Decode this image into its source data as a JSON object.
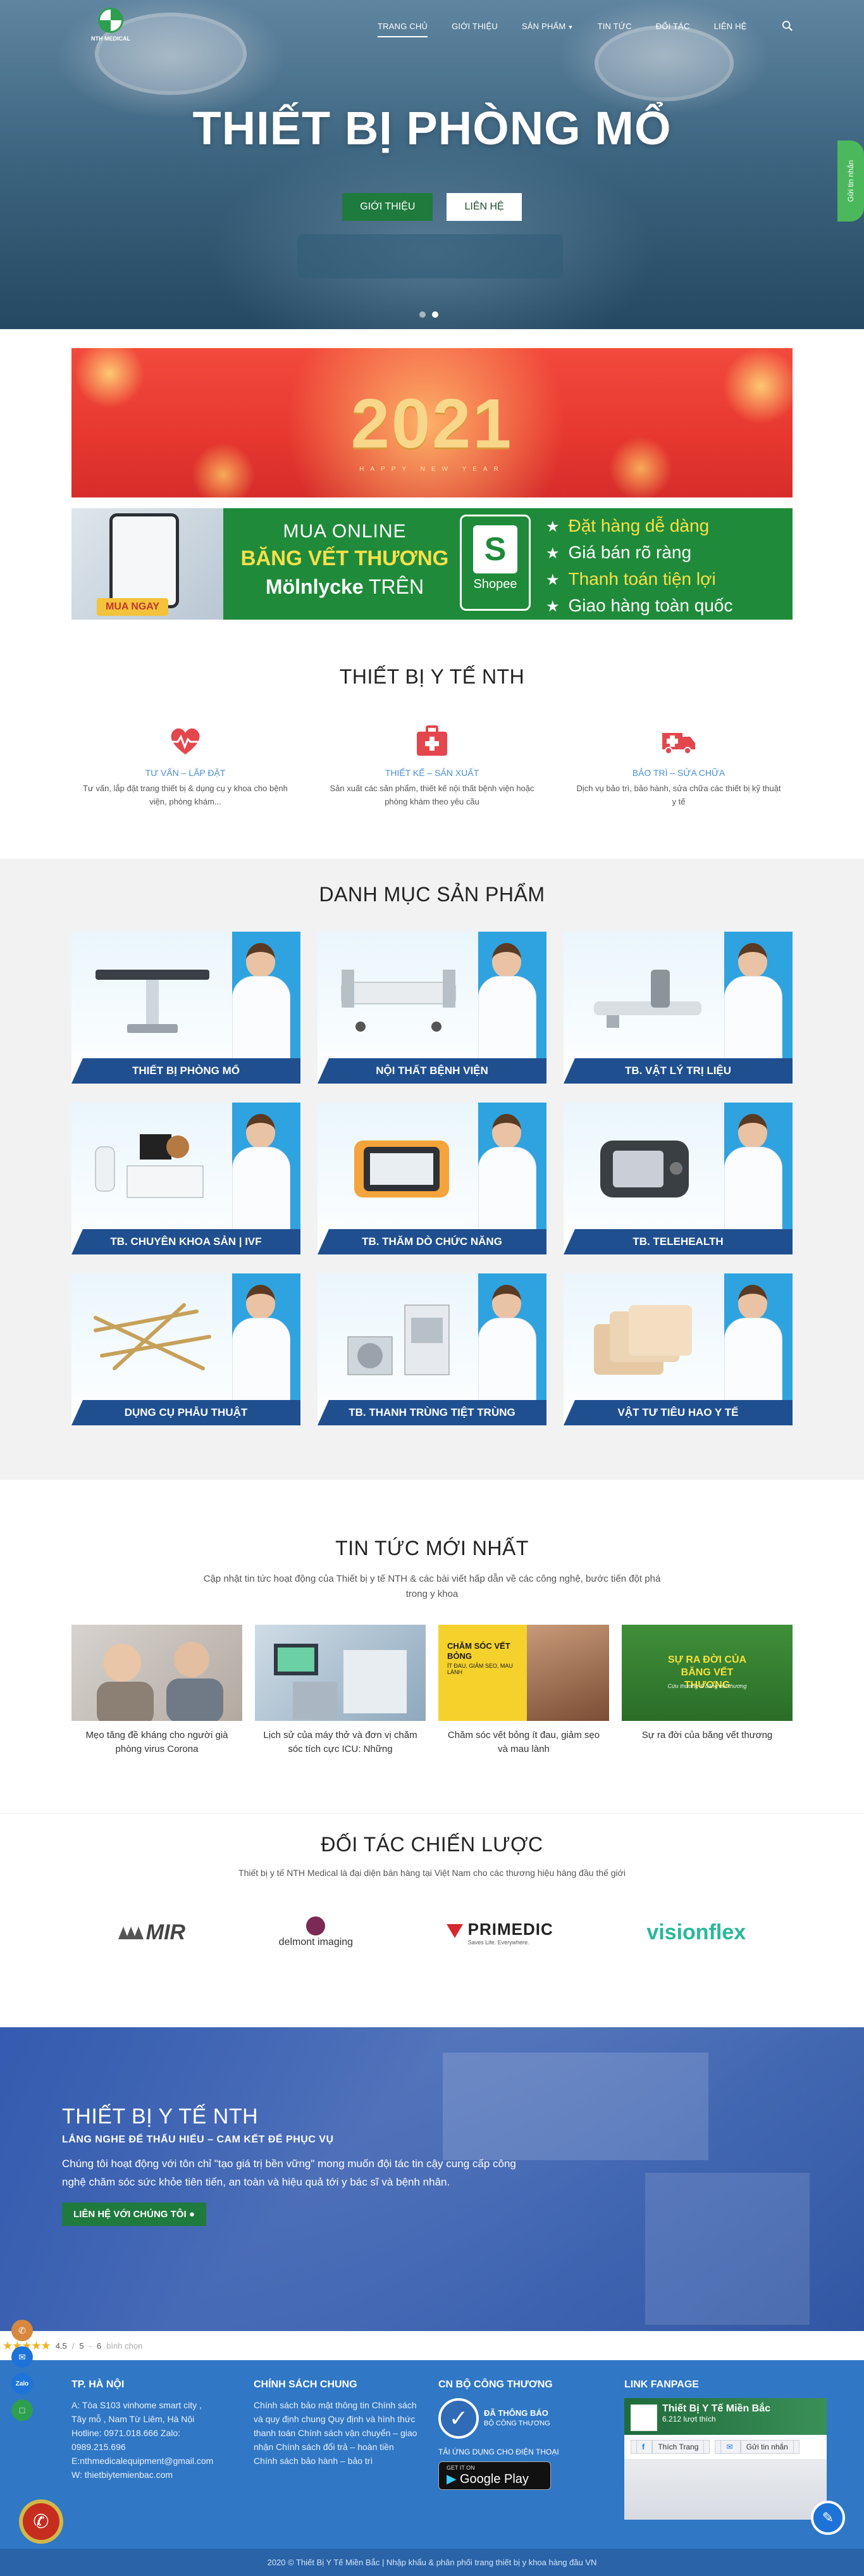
{
  "brand": {
    "logo_text": "NTH MEDICAL"
  },
  "nav": {
    "items": [
      {
        "label": "TRANG CHỦ",
        "active": true
      },
      {
        "label": "GIỚI THIỆU"
      },
      {
        "label": "SẢN PHẨM",
        "dropdown": true
      },
      {
        "label": "TIN TỨC"
      },
      {
        "label": "ĐỐI TÁC"
      },
      {
        "label": "LIÊN HỆ"
      }
    ]
  },
  "hero": {
    "title": "THIẾT BỊ PHÒNG MỔ",
    "primary_button": "GIỚI THIỆU",
    "secondary_button": "LIÊN HỆ",
    "side_tab": "Gửi tin nhắn"
  },
  "banners": {
    "year": "2021",
    "year_sub": "HAPPY NEW YEAR",
    "shop": {
      "buy_now": "MUA NGAY",
      "line1": "MUA ONLINE",
      "line2": "BĂNG VẾT THƯƠNG",
      "brand": "Mölnlycke",
      "line3_suffix": "TRÊN",
      "shopee": "Shopee",
      "features": [
        "Đặt hàng dễ dàng",
        "Giá bán rõ ràng",
        "Thanh toán tiện lợi",
        "Giao hàng toàn quốc"
      ]
    }
  },
  "services": {
    "title": "THIẾT BỊ Y TẾ NTH",
    "items": [
      {
        "title": "TƯ VẤN – LẮP ĐẶT",
        "desc": "Tư vấn, lắp đặt trang thiết bị & dụng cụ y khoa cho bệnh viện, phòng khám...",
        "icon": "heartbeat-icon"
      },
      {
        "title": "THIẾT KẾ – SẢN XUẤT",
        "desc": "Sản xuất các sản phẩm, thiết kế nội thất bệnh viện hoặc phòng khám theo yêu cầu",
        "icon": "medical-kit-icon"
      },
      {
        "title": "BẢO TRÌ – SỬA CHỮA",
        "desc": "Dịch vụ bảo trì, bảo hành, sửa chữa các thiết bị kỹ thuật y tế",
        "icon": "ambulance-icon"
      }
    ]
  },
  "categories": {
    "title": "DANH MỤC SẢN PHẨM",
    "items": [
      {
        "label": "THIẾT BỊ PHÒNG MỔ"
      },
      {
        "label": "NỘI THẤT BỆNH VIỆN"
      },
      {
        "label": "TB. VẬT LÝ TRỊ LIỆU"
      },
      {
        "label": "TB. CHUYÊN KHOA SẢN | IVF"
      },
      {
        "label": "TB. THĂM DÒ CHỨC NĂNG"
      },
      {
        "label": "TB. TELEHEALTH"
      },
      {
        "label": "DỤNG CỤ PHẪU THUẬT"
      },
      {
        "label": "TB. THANH TRÙNG TIỆT TRÙNG"
      },
      {
        "label": "VẬT TƯ TIÊU HAO Y TẾ"
      }
    ]
  },
  "news": {
    "title": "TIN TỨC MỚI NHẤT",
    "lead": "Cập nhật tin tức hoạt động của Thiết bị y tế NTH & các bài viết hấp dẫn về các công nghệ, bước tiến đột phá trong y khoa",
    "items": [
      {
        "title": "Mẹo tăng đề kháng cho người già phòng virus Corona"
      },
      {
        "title": "Lịch sử của máy thở và đơn vị chăm sóc tích cực ICU: Những"
      },
      {
        "title": "Chăm sóc vết bỏng ít đau, giảm sẹo và mau lành",
        "thumb_text": "CHĂM SÓC VẾT BỎNG",
        "thumb_sub": "ÍT ĐAU, GIẢM SẸO, MAU LÀNH"
      },
      {
        "title": "Sự ra đời của băng vết thương",
        "thumb_text": "SỰ RA ĐỜI CỦA BĂNG VẾT THƯƠNG",
        "thumb_sub": "Cứu thương & băng vết thương"
      }
    ]
  },
  "partners": {
    "title": "ĐỐI TÁC CHIẾN LƯỢC",
    "lead": "Thiết bị y tế NTH Medical là đại diện bán hàng tại Việt Nam cho các thương hiệu hàng đầu thế giới",
    "logos": [
      "MIR",
      "delmont imaging",
      "PRIMEDIC",
      "visionflex"
    ],
    "primedic_tag": "Saves Life. Everywhere."
  },
  "about": {
    "title": "THIẾT BỊ Y TẾ NTH",
    "slogan": "LẮNG NGHE ĐỂ THẤU HIỂU – CAM KẾT ĐỂ PHỤC VỤ",
    "text": "Chúng tôi hoạt động với tôn chỉ \"tạo giá trị bền vững\" mong muốn đội tác tin cậy cung cấp công nghệ chăm sóc sức khỏe tiên tiến, an toàn và hiệu quả tới y bác sĩ và bệnh nhân.",
    "cta": "LIÊN HỆ VỚI CHÚNG TÔI"
  },
  "rating": {
    "score": "4.5",
    "max": "5",
    "count": "6",
    "suffix": "bình chọn"
  },
  "footer": {
    "hanoi": {
      "title": "TP. HÀ NỘI",
      "lines": [
        "A: Tòa S103 vinhome smart city ,",
        "Tây mỗ , Nam Từ Liêm, Hà Nội",
        "Hotline: 0971.018.666 Zalo:",
        "0989.215.696",
        "E:nthmedicalequipment@gmail.com",
        "W: thietbiytemienbac.com"
      ]
    },
    "policy": {
      "title": "CHÍNH SÁCH CHUNG",
      "text": "Chính sách bảo mật thông tin Chính sách và quy định chung Quy định và hình thức thanh toán Chính sách vận chuyển – giao nhận Chính sách đổi trả – hoàn tiền Chính sách bảo hành – bảo trì"
    },
    "ministry": {
      "title": "CN BỘ CÔNG THƯƠNG",
      "cert_main": "ĐÃ THÔNG BÁO",
      "cert_sub": "BỘ CÔNG THƯƠNG",
      "app_title": "TẢI ỨNG DỤNG CHO ĐIỆN THOẠI",
      "gplay_small": "GET IT ON",
      "gplay_big": "Google Play"
    },
    "fanpage": {
      "title": "LINK FANPAGE",
      "name": "Thiết Bị Y Tế Miền Bắc",
      "likes": "6.212 lượt thích",
      "like_btn": "Thích Trang",
      "msg_btn": "Gửi tin nhắn"
    },
    "copyright": "2020 © Thiết Bị Y Tế Miền Bắc | Nhập khẩu & phân phối trang thiết bị y khoa hàng đầu VN"
  },
  "colors": {
    "green": "#1f7a3e",
    "blue_footer": "#3077c5",
    "label_blue": "#1f4f8f",
    "accent_blue": "#4a8fd4"
  }
}
